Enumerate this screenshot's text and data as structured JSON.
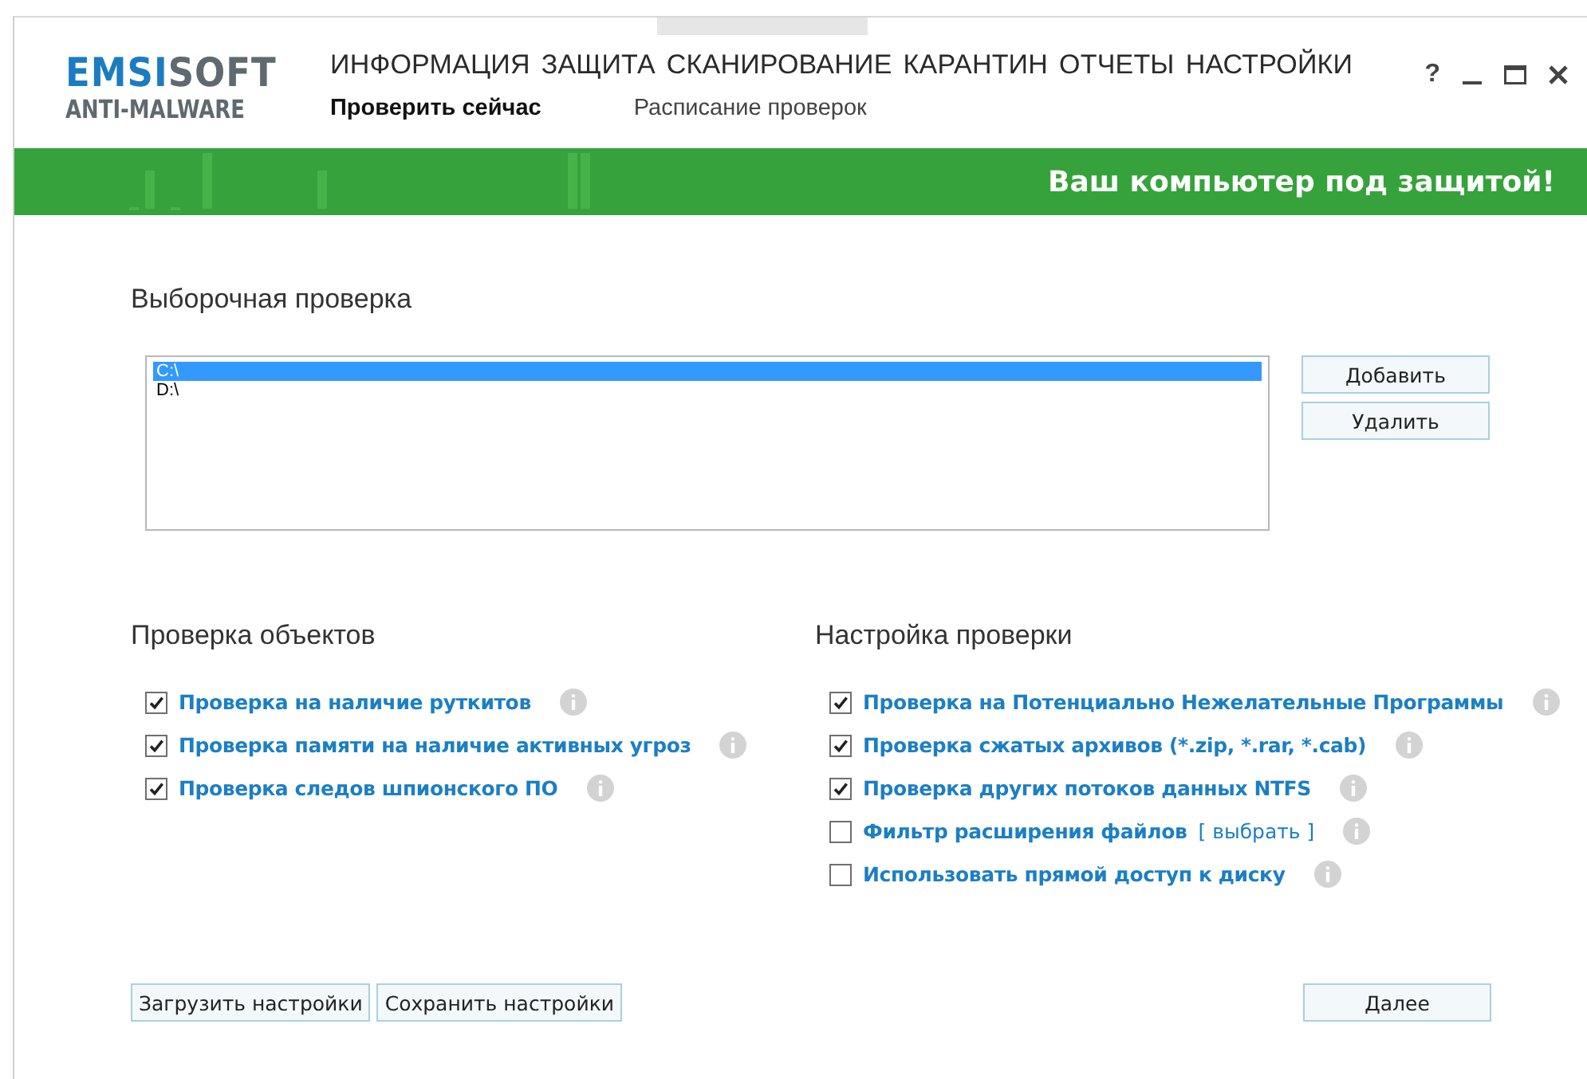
{
  "logo": {
    "name_accent": "EMSI",
    "name_rest": "SOFT",
    "subtitle": "ANTI-MALWARE"
  },
  "menu": [
    {
      "label": "ИНФОРМАЦИЯ"
    },
    {
      "label": "ЗАЩИТА"
    },
    {
      "label": "СКАНИРОВАНИЕ"
    },
    {
      "label": "КАРАНТИН"
    },
    {
      "label": "ОТЧЕТЫ"
    },
    {
      "label": "НАСТРОЙКИ"
    }
  ],
  "subtabs": [
    {
      "label": "Проверить сейчас",
      "selected": true
    },
    {
      "label": "Расписание проверок",
      "selected": false
    }
  ],
  "help": "?",
  "status_banner": "Ваш компьютер под защитой!",
  "custom_scan": {
    "title": "Выборочная проверка",
    "drives": [
      {
        "label": "C:\\",
        "selected": true
      },
      {
        "label": "D:\\",
        "selected": false
      }
    ],
    "buttons": [
      "Добавить",
      "Удалить"
    ]
  },
  "object_checks": {
    "title": "Проверка объектов",
    "options": [
      {
        "label": "Проверка на наличие руткитов",
        "checked": true
      },
      {
        "label": "Проверка памяти на наличие активных угроз",
        "checked": true
      },
      {
        "label": "Проверка следов шпионского ПО",
        "checked": true
      }
    ]
  },
  "scan_settings": {
    "title": "Настройка проверки",
    "options": [
      {
        "label": "Проверка на Потенциально Нежелательные Программы",
        "checked": true
      },
      {
        "label": "Проверка сжатых архивов (*.zip, *.rar, *.cab)",
        "checked": true
      },
      {
        "label": "Проверка других потоков данных NTFS",
        "checked": true
      },
      {
        "label": "Фильтр расширения файлов",
        "checked": false,
        "link": "[ выбрать ]"
      },
      {
        "label": "Использовать прямой доступ к диску",
        "checked": false
      }
    ]
  },
  "footer_buttons": {
    "left": [
      "Загрузить настройки",
      "Сохранить настройки"
    ],
    "right": "Далее"
  }
}
